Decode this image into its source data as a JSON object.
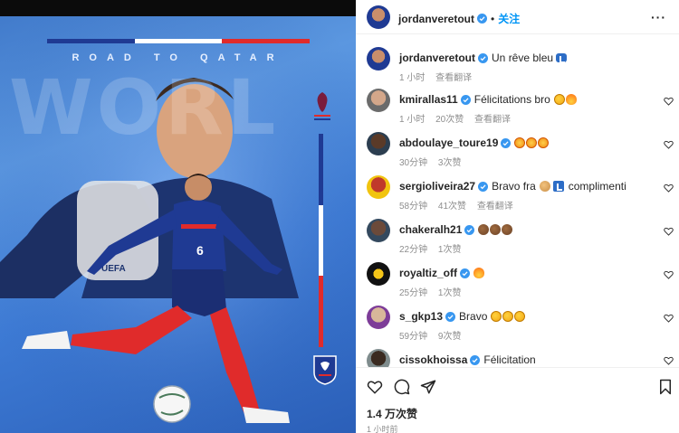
{
  "post_image": {
    "banner_text": "ROAD TO QATAR",
    "big_word": "WORL",
    "colors": {
      "blue": "#1f3a93",
      "white": "#ffffff",
      "red": "#e02b2b"
    }
  },
  "header": {
    "username": "jordanveretout",
    "separator": "•",
    "follow_label": "关注",
    "more_label": "···"
  },
  "caption": {
    "username": "jordanveretout",
    "text": "Un rêve bleu",
    "time": "1 小时",
    "translate": "查看翻译"
  },
  "comments": [
    {
      "username": "kmirallas11",
      "text": "Félicitations bro",
      "emojis": [
        "clap",
        "fire"
      ],
      "time": "1 小时",
      "likes": "20次赞",
      "translate": "查看翻译"
    },
    {
      "username": "abdoulaye_toure19",
      "text": "",
      "emojis": [
        "star",
        "star",
        "star"
      ],
      "time": "30分钟",
      "likes": "3次赞",
      "translate": ""
    },
    {
      "username": "sergioliveira27",
      "text": "Bravo fra",
      "emojis": [
        "muscle"
      ],
      "text2": "complimenti",
      "time": "58分钟",
      "likes": "41次赞",
      "translate": "查看翻译"
    },
    {
      "username": "chakeralh21",
      "text": "",
      "emojis": [
        "fist",
        "fist",
        "fist"
      ],
      "time": "22分钟",
      "likes": "1次赞",
      "translate": ""
    },
    {
      "username": "royaltiz_off",
      "text": "",
      "emojis": [
        "fire"
      ],
      "time": "25分钟",
      "likes": "1次赞",
      "translate": ""
    },
    {
      "username": "s_gkp13",
      "text": "Bravo",
      "emojis": [
        "clap",
        "clap",
        "clap"
      ],
      "time": "59分钟",
      "likes": "9次赞",
      "translate": ""
    },
    {
      "username": "cissokhoissa",
      "text": "Félicitation",
      "emojis": [],
      "time": "",
      "likes": "",
      "translate": ""
    }
  ],
  "actions": {
    "icons": [
      "heart-icon",
      "comment-icon",
      "share-icon",
      "bookmark-icon"
    ],
    "likes": "1.4 万次赞",
    "posted": "1 小时前"
  }
}
